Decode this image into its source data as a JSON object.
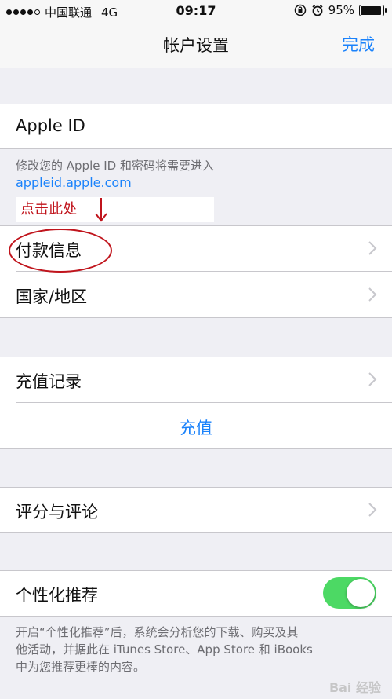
{
  "status_bar": {
    "carrier": "中国联通",
    "network": "4G",
    "time": "09:17",
    "battery_percent": "95%",
    "battery_level": 0.95
  },
  "nav": {
    "title": "帐户设置",
    "done_label": "完成"
  },
  "apple_id": {
    "label": "Apple ID",
    "note": "修改您的 Apple ID 和密码将需要进入",
    "link": "appleid.apple.com"
  },
  "annotation": {
    "text": "点击此处"
  },
  "payment_section": {
    "items": [
      {
        "label": "付款信息"
      },
      {
        "label": "国家/地区"
      }
    ]
  },
  "purchase_section": {
    "history_label": "充值记录",
    "topup_label": "充值"
  },
  "ratings_section": {
    "label": "评分与评论"
  },
  "personalization": {
    "label": "个性化推荐",
    "enabled": true,
    "toggle_color": "#4cd964",
    "note_lines": [
      "开启“个性化推荐”后，系统会分析您的下载、购买及其",
      "他活动，并据此在 iTunes Store、App Store 和 iBooks",
      "中为您推荐更棒的内容。"
    ]
  },
  "watermark": "Bai 经验",
  "colors": {
    "accent": "#1a82fb",
    "annotation": "#c0141c",
    "background": "#efeff4"
  }
}
